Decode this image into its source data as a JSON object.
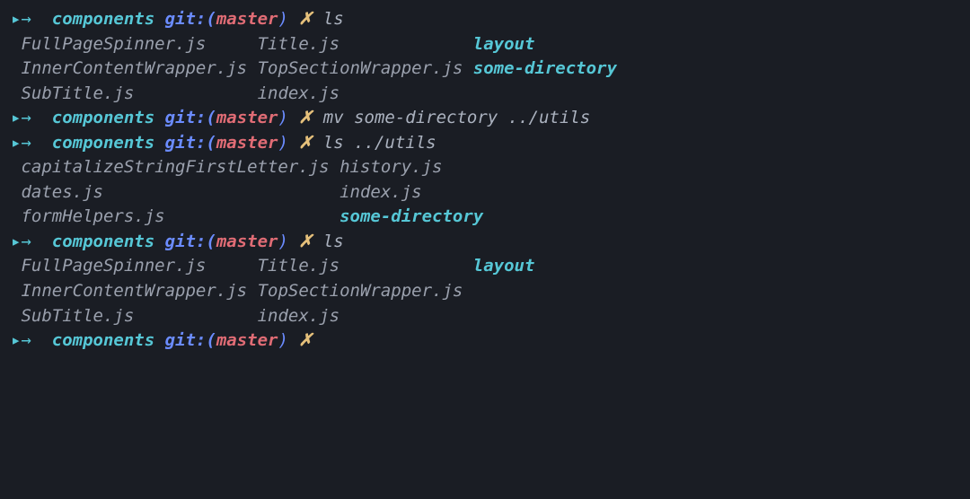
{
  "prompt": {
    "arrow": "▸→",
    "dir": "components",
    "git": "git:(",
    "branch": "master",
    "close": ")",
    "dirty": "✗"
  },
  "commands": {
    "c1": "ls",
    "c2": "mv some-directory ../utils",
    "c3": "ls ../utils",
    "c4": "ls",
    "c5": ""
  },
  "out1": {
    "l1a": "FullPageSpinner.js",
    "l1b": "Title.js",
    "l1c": "layout",
    "l2a": "InnerContentWrapper.js",
    "l2b": "TopSectionWrapper.js",
    "l2c": "some-directory",
    "l3a": "SubTitle.js",
    "l3b": "index.js"
  },
  "out3": {
    "l1a": "capitalizeStringFirstLetter.js",
    "l1b": "history.js",
    "l2a": "dates.js",
    "l2b": "index.js",
    "l3a": "formHelpers.js",
    "l3b": "some-directory"
  },
  "out4": {
    "l1a": "FullPageSpinner.js",
    "l1b": "Title.js",
    "l1c": "layout",
    "l2a": "InnerContentWrapper.js",
    "l2b": "TopSectionWrapper.js",
    "l3a": "SubTitle.js",
    "l3b": "index.js"
  },
  "cols": {
    "a": 23,
    "a2": 31,
    "b": 21,
    "pad1": " ",
    "pad2": "  "
  }
}
